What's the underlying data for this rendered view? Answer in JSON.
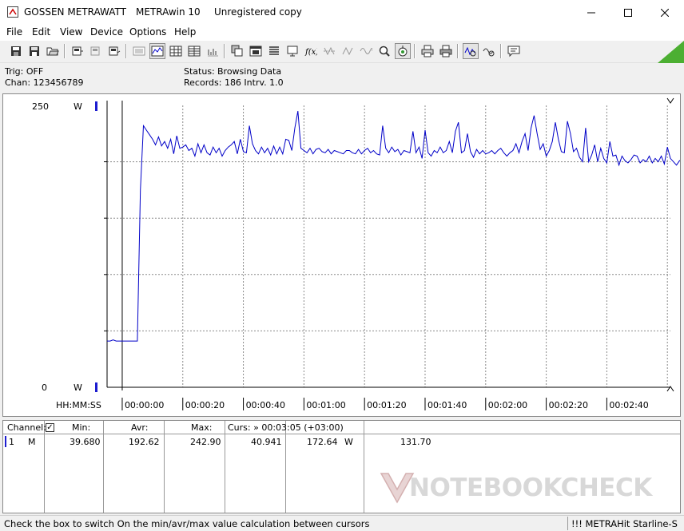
{
  "window": {
    "vendor": "GOSSEN METRAWATT",
    "app": "METRAwin 10",
    "license": "Unregistered copy"
  },
  "menu": [
    "File",
    "Edit",
    "View",
    "Device",
    "Options",
    "Help"
  ],
  "status": {
    "trig": "Trig: OFF",
    "chan": "Chan:  123456789",
    "status_label": "Status:",
    "status_value": "Browsing Data",
    "records": "Records: 186  Intrv. 1.0"
  },
  "chart_data": {
    "type": "line",
    "y_top_label": "250",
    "y_bottom_label": "0",
    "y_unit": "W",
    "ylim": [
      0,
      250
    ],
    "x_axis_label": "HH:MM:SS",
    "x_ticks": [
      "00:00:00",
      "00:00:20",
      "00:00:40",
      "00:01:00",
      "00:01:20",
      "00:01:40",
      "00:02:00",
      "00:02:20",
      "00:02:40"
    ],
    "x_start_s": -5,
    "x_range_s": [
      -5,
      181
    ],
    "grid": true,
    "line_color": "#0000c8",
    "series": [
      {
        "values": [
          41,
          41,
          42,
          41,
          41,
          41,
          41,
          41,
          41,
          41,
          41,
          175,
          232,
          228,
          224,
          220,
          215,
          222,
          214,
          218,
          212,
          220,
          207,
          223,
          212,
          213,
          215,
          210,
          212,
          205,
          216,
          208,
          215,
          208,
          206,
          213,
          208,
          212,
          205,
          210,
          213,
          215,
          218,
          207,
          220,
          209,
          208,
          232,
          216,
          210,
          207,
          213,
          208,
          212,
          206,
          214,
          207,
          213,
          207,
          220,
          219,
          210,
          230,
          245,
          212,
          210,
          208,
          212,
          207,
          211,
          212,
          209,
          208,
          211,
          207,
          210,
          209,
          208,
          207,
          210,
          210,
          208,
          207,
          211,
          207,
          210,
          212,
          208,
          210,
          207,
          206,
          232,
          212,
          208,
          213,
          209,
          211,
          206,
          210,
          209,
          208,
          227,
          208,
          213,
          203,
          228,
          208,
          205,
          210,
          208,
          213,
          208,
          210,
          218,
          208,
          227,
          235,
          208,
          210,
          225,
          209,
          204,
          211,
          207,
          210,
          207,
          208,
          210,
          207,
          210,
          212,
          208,
          205,
          208,
          210,
          216,
          208,
          218,
          225,
          210,
          230,
          241,
          225,
          211,
          216,
          205,
          210,
          218,
          235,
          220,
          209,
          208,
          236,
          225,
          209,
          212,
          204,
          200,
          230,
          200,
          206,
          215,
          200,
          212,
          203,
          199,
          218,
          205,
          206,
          197,
          205,
          201,
          199,
          202,
          206,
          205,
          199,
          202,
          200,
          205,
          199,
          203,
          200,
          205,
          198,
          213,
          203,
          200,
          197,
          201,
          200,
          204,
          196,
          223,
          213,
          230,
          225,
          200,
          195,
          209,
          198,
          230,
          196,
          193
        ]
      }
    ]
  },
  "table": {
    "headers": {
      "channel": "Channel:",
      "min": "Min:",
      "avr": "Avr:",
      "max": "Max:",
      "curs": "Curs: » 00:03:05 (+03:00)"
    },
    "row": {
      "num": "1",
      "mode": "M",
      "min": "39.680",
      "avr": "192.62",
      "max": "242.90",
      "c1": "40.941",
      "c2": "172.64",
      "unit": "W",
      "c3": "131.70"
    }
  },
  "watermark": "NOTEBOOKCHECK",
  "statusbar": {
    "hint": "Check the box to switch On the min/avr/max value calculation between cursors",
    "device": "!!! METRAHit Starline-S"
  },
  "colors": {
    "plot_line": "#0000c8",
    "cursor_mark": "#1c1ccf",
    "corner_green": "#4caf32"
  }
}
